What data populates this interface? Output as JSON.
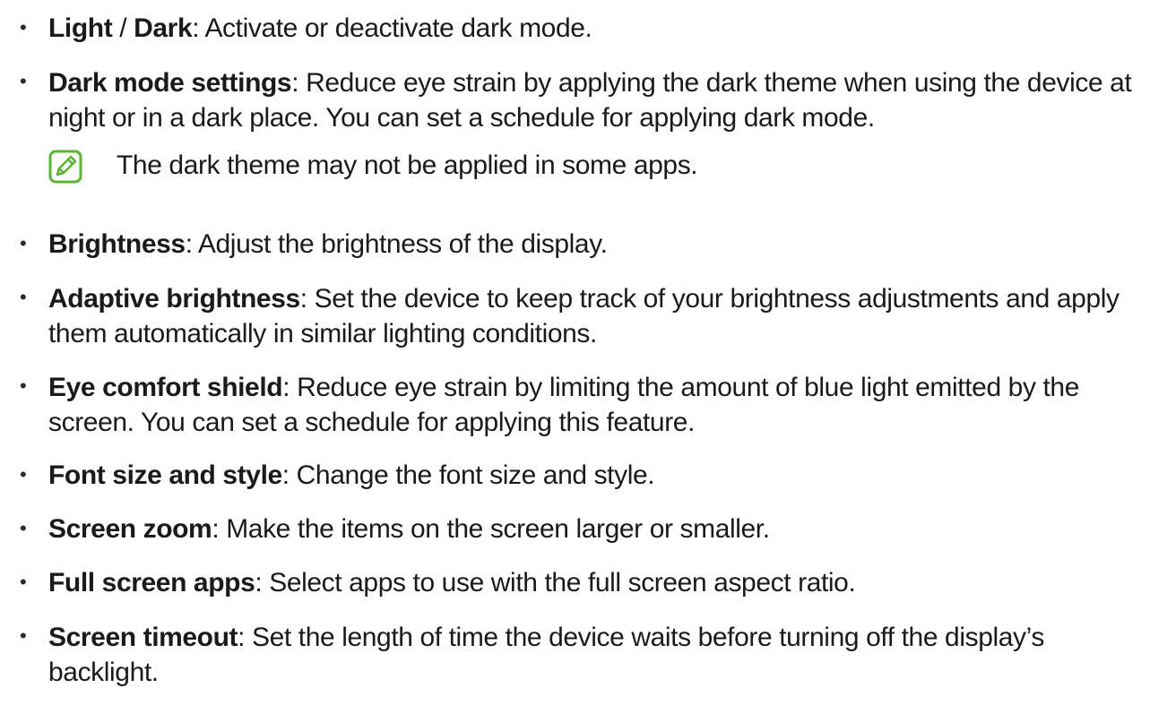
{
  "items": [
    {
      "term_a": "Light",
      "sep": " / ",
      "term_b": "Dark",
      "desc": ": Activate or deactivate dark mode."
    },
    {
      "term": "Dark mode settings",
      "desc": ": Reduce eye strain by applying the dark theme when using the device at night or in a dark place. You can set a schedule for applying dark mode."
    },
    {
      "term": "Brightness",
      "desc": ": Adjust the brightness of the display."
    },
    {
      "term": "Adaptive brightness",
      "desc": ": Set the device to keep track of your brightness adjustments and apply them automatically in similar lighting conditions."
    },
    {
      "term": "Eye comfort shield",
      "desc": ": Reduce eye strain by limiting the amount of blue light emitted by the screen. You can set a schedule for applying this feature."
    },
    {
      "term": "Font size and style",
      "desc": ": Change the font size and style."
    },
    {
      "term": "Screen zoom",
      "desc": ": Make the items on the screen larger or smaller."
    },
    {
      "term": "Full screen apps",
      "desc": ": Select apps to use with the full screen aspect ratio."
    },
    {
      "term": "Screen timeout",
      "desc": ": Set the length of time the device waits before turning off the display’s backlight."
    }
  ],
  "bullet_glyph": "•",
  "note": {
    "text": "The dark theme may not be applied in some apps.",
    "icon": "note-pencil-icon",
    "icon_color": "#5bb531"
  }
}
